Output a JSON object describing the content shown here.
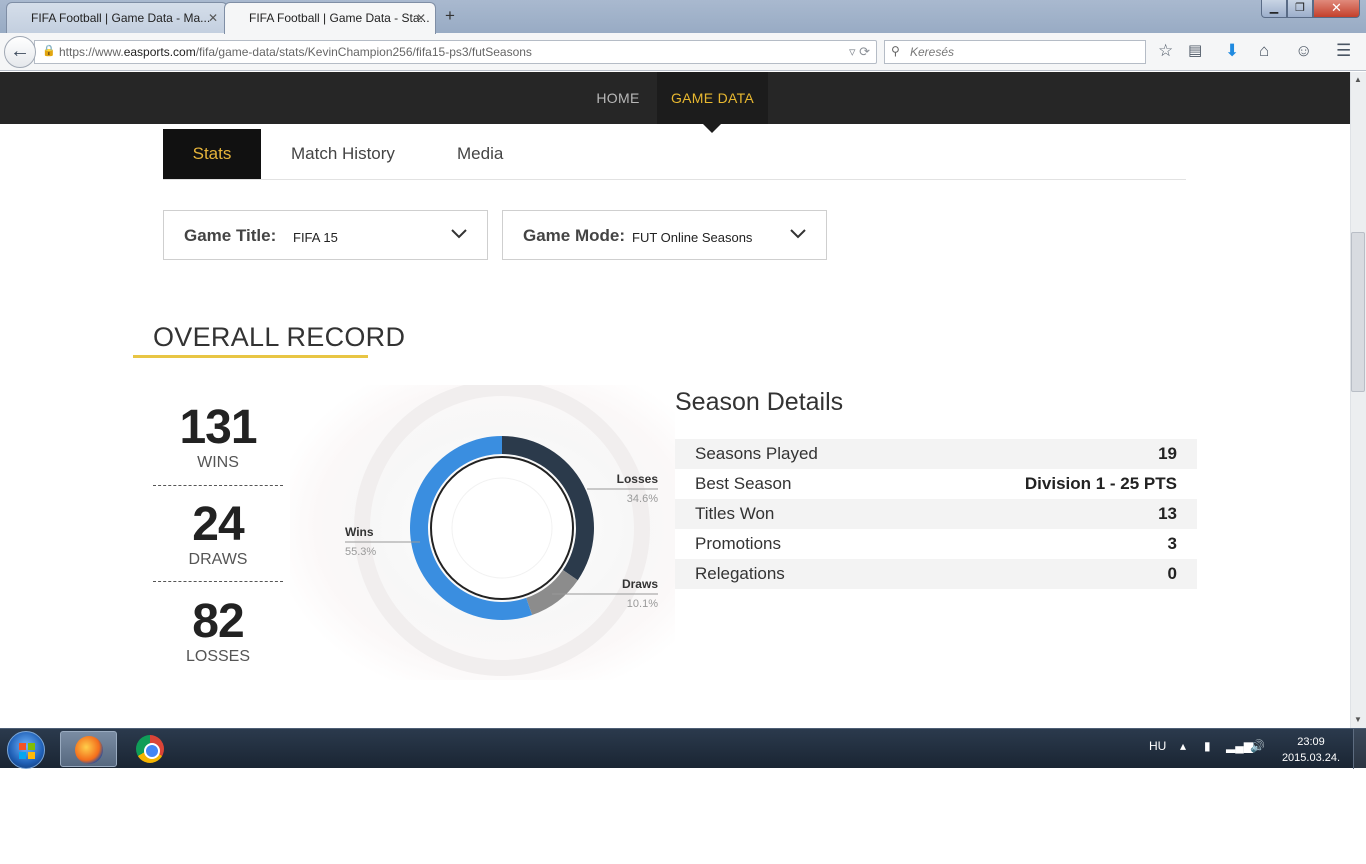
{
  "browser": {
    "tabs": [
      {
        "title": "FIFA Football | Game Data - Ma..."
      },
      {
        "title": "FIFA Football | Game Data - Sta..."
      }
    ],
    "url_prefix": "https://www.",
    "url_domain": "easports.com",
    "url_path": "/fifa/game-data/stats/KevinChampion256/fifa15-ps3/futSeasons",
    "search_placeholder": "Keresés"
  },
  "site_nav": {
    "home": "HOME",
    "game_data": "GAME DATA"
  },
  "subtabs": {
    "stats": "Stats",
    "match_history": "Match History",
    "media": "Media"
  },
  "filters": {
    "game_title_label": "Game Title:",
    "game_title_value": "FIFA 15",
    "game_mode_label": "Game Mode:",
    "game_mode_value": "FUT Online Seasons"
  },
  "overall": {
    "title": "OVERALL RECORD",
    "wins": "131",
    "wins_label": "WINS",
    "draws": "24",
    "draws_label": "DRAWS",
    "losses": "82",
    "losses_label": "LOSSES"
  },
  "chart_data": {
    "type": "pie",
    "slices": [
      {
        "name": "Wins",
        "pct_label": "55.3%",
        "value": 55.3,
        "color": "#3a8ee0"
      },
      {
        "name": "Losses",
        "pct_label": "34.6%",
        "value": 34.6,
        "color": "#2b3a4b"
      },
      {
        "name": "Draws",
        "pct_label": "10.1%",
        "value": 10.1,
        "color": "#8c8c8c"
      }
    ]
  },
  "season_details": {
    "title": "Season Details",
    "rows": [
      {
        "label": "Seasons Played",
        "value": "19"
      },
      {
        "label": "Best Season",
        "value": "Division 1 - 25 PTS"
      },
      {
        "label": "Titles Won",
        "value": "13"
      },
      {
        "label": "Promotions",
        "value": "3"
      },
      {
        "label": "Relegations",
        "value": "0"
      }
    ]
  },
  "taskbar": {
    "language": "HU",
    "time": "23:09",
    "date": "2015.03.24."
  },
  "colors": {
    "accent_gold": "#e8b830",
    "header_dark": "#262626",
    "wins_blue": "#3a8ee0",
    "losses_navy": "#2b3a4b",
    "draws_gray": "#8c8c8c"
  }
}
